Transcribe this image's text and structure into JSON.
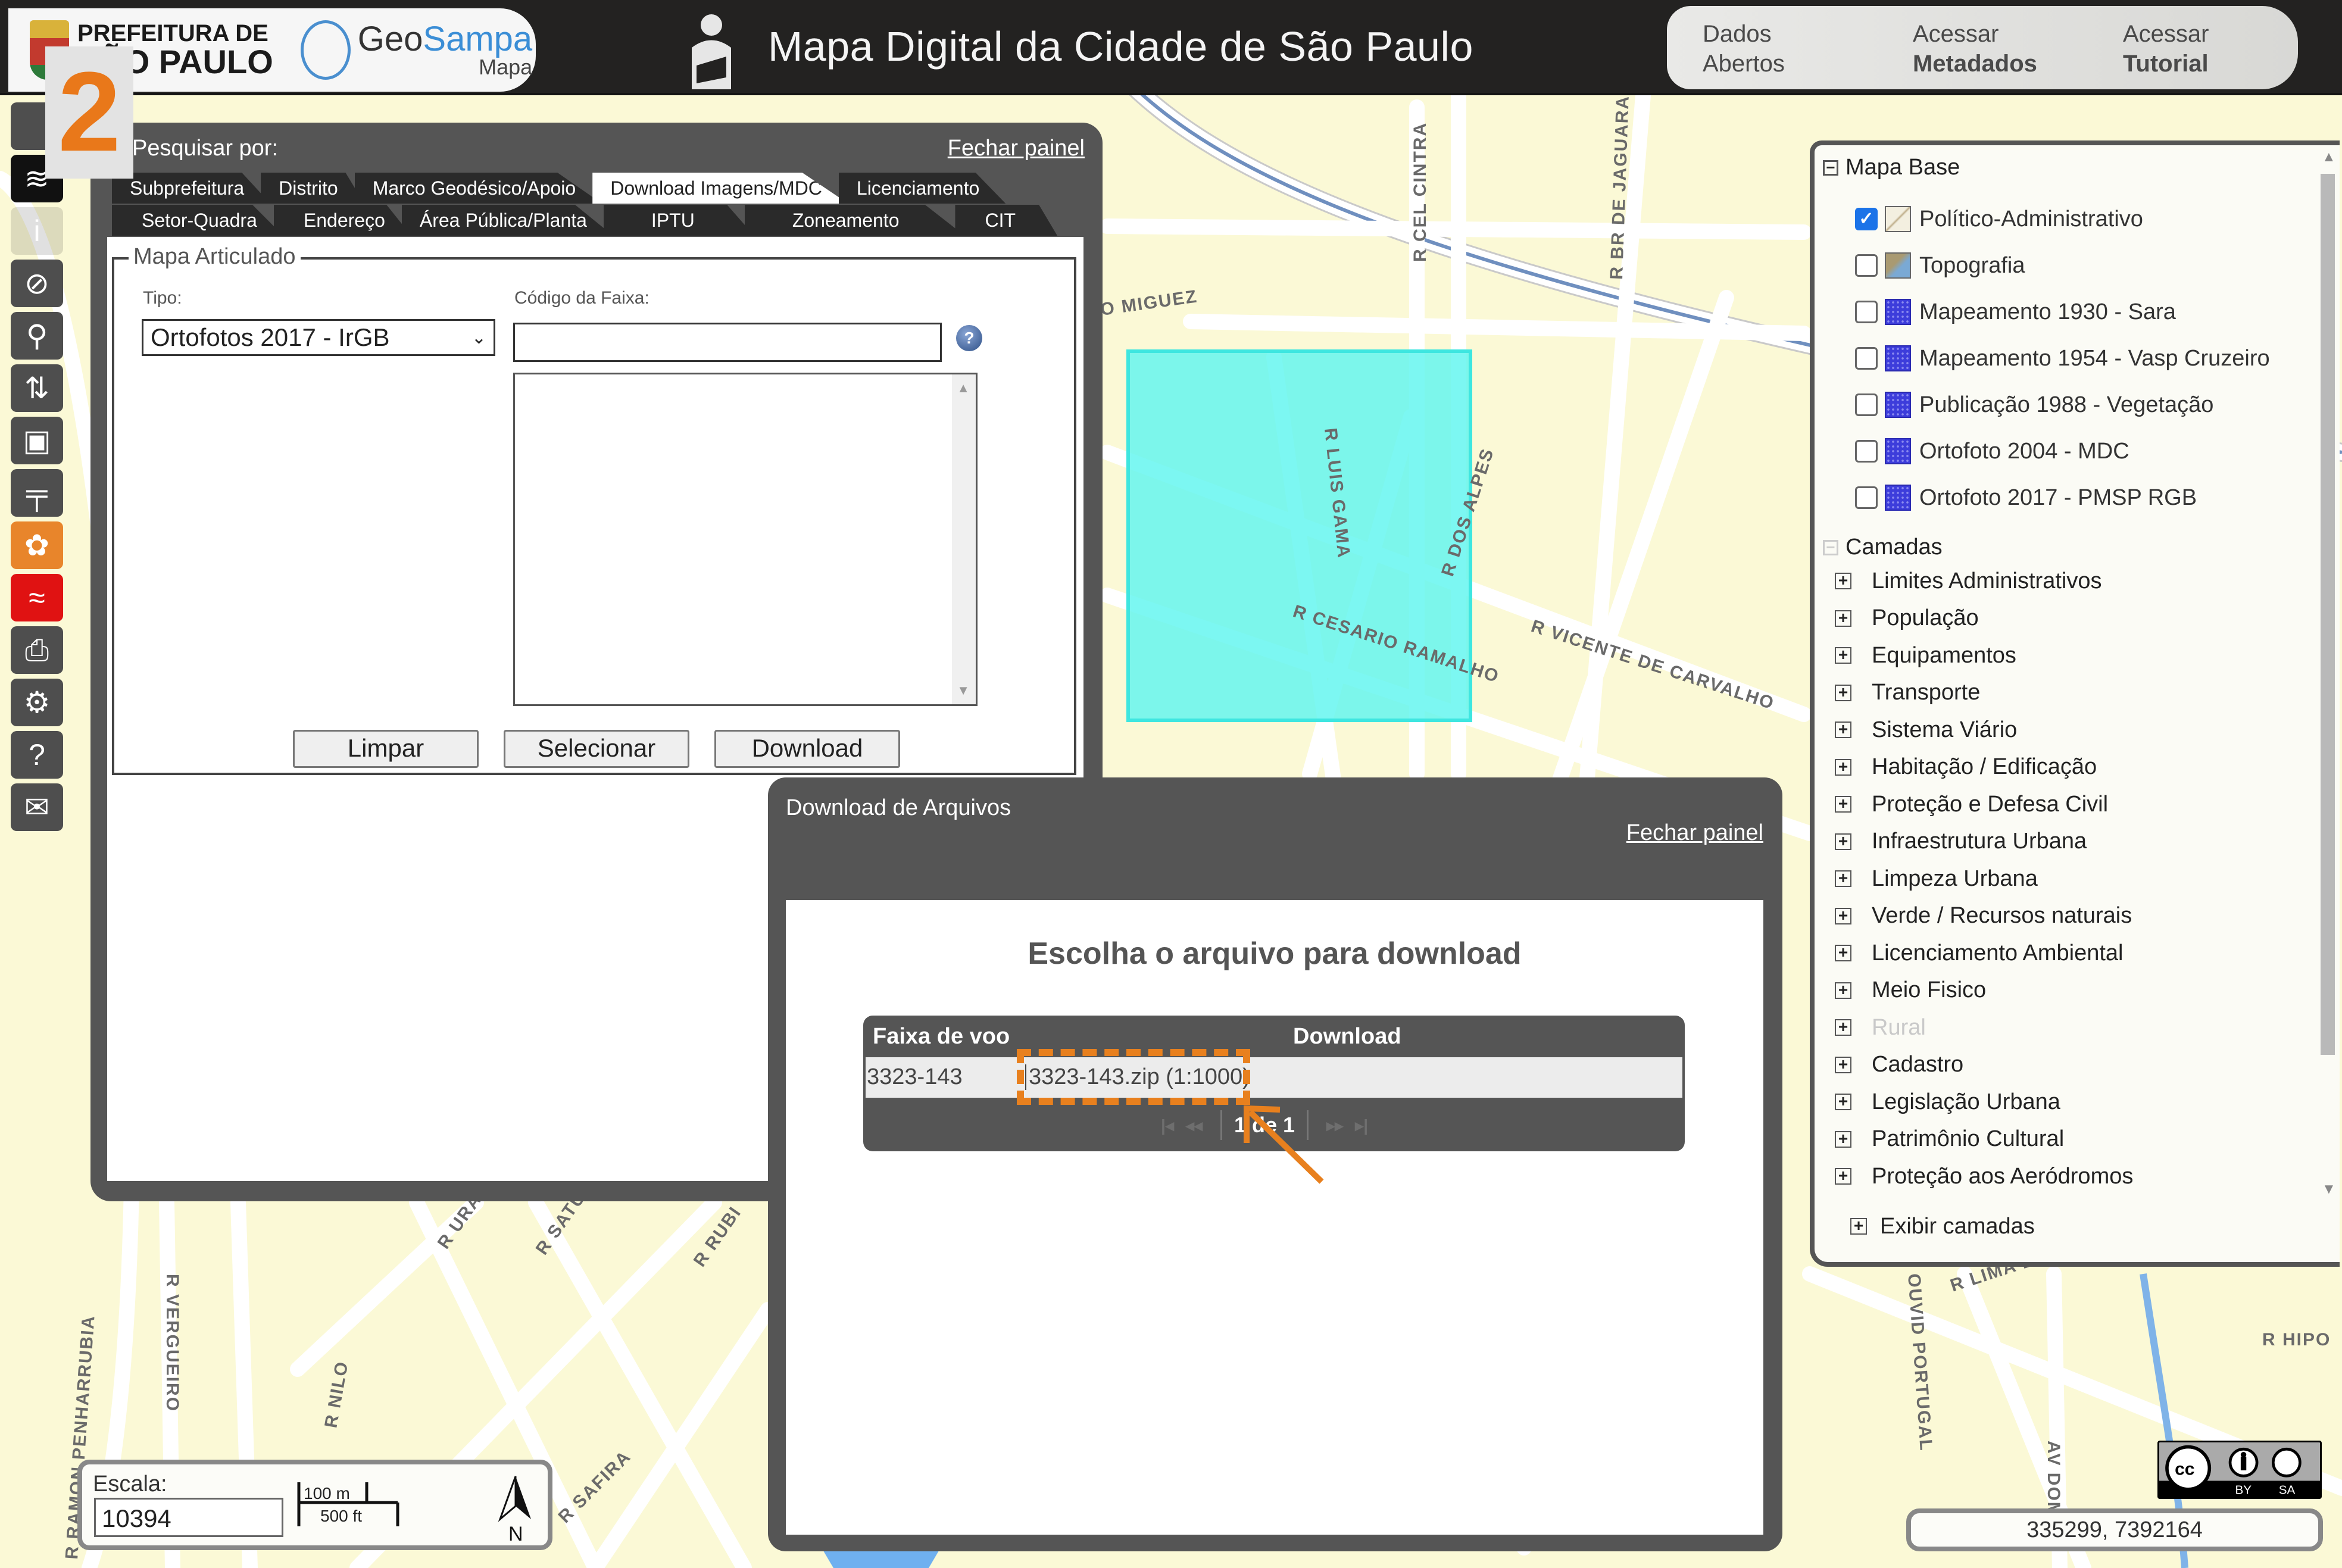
{
  "header": {
    "prefeitura_line1": "PREFEITURA DE",
    "prefeitura_line2": "SÃO PAULO",
    "geo_brand_a": "Geo",
    "geo_brand_b": "Sampa",
    "geo_sub": "Mapa",
    "title": "Mapa Digital da Cidade de São Paulo",
    "links": [
      {
        "line1": "Dados",
        "line2": "Abertos"
      },
      {
        "line1": "Acessar",
        "line2": "Metadados"
      },
      {
        "line1": "Acessar",
        "line2": "Tutorial"
      }
    ]
  },
  "step_badge": "2",
  "toolbar": {
    "items": [
      {
        "icon": "blank-tool-icon",
        "glyph": ""
      },
      {
        "icon": "layers-icon",
        "glyph": "≋"
      },
      {
        "icon": "street-view-icon",
        "glyph": "i"
      },
      {
        "icon": "measure-disabled-icon",
        "glyph": "⊘"
      },
      {
        "icon": "search-icon",
        "glyph": "⚲"
      },
      {
        "icon": "route-icon",
        "glyph": "⇅"
      },
      {
        "icon": "save-icon",
        "glyph": "▣"
      },
      {
        "icon": "ruler-icon",
        "glyph": "╤"
      },
      {
        "icon": "palette-icon",
        "glyph": "✿"
      },
      {
        "icon": "flood-icon",
        "glyph": "≈"
      },
      {
        "icon": "print-icon",
        "glyph": "⎙"
      },
      {
        "icon": "settings-icon",
        "glyph": "⚙"
      },
      {
        "icon": "help-icon",
        "glyph": "?"
      },
      {
        "icon": "mail-icon",
        "glyph": "✉"
      }
    ]
  },
  "search_panel": {
    "title": "Pesquisar por:",
    "close": "Fechar painel",
    "tabs_row1": [
      "Subprefeitura",
      "Distrito",
      "Marco Geodésico/Apoio",
      "Download Imagens/MDC",
      "Licenciamento"
    ],
    "tabs_row2": [
      "Setor-Quadra",
      "Endereço",
      "Área Pública/Planta",
      "IPTU",
      "Zoneamento",
      "CIT"
    ],
    "active_tab": "Download Imagens/MDC",
    "fieldset_legend": "Mapa Articulado",
    "tipo_label": "Tipo:",
    "tipo_value": "Ortofotos 2017 - IrGB",
    "codigo_label": "Código da Faixa:",
    "codigo_value": "",
    "help_glyph": "?",
    "buttons": {
      "clear": "Limpar",
      "select": "Selecionar",
      "download": "Download"
    }
  },
  "layer_panel": {
    "base_title": "Mapa Base",
    "base_items": [
      {
        "label": "Político-Administrativo",
        "checked": true,
        "thumb": "pol"
      },
      {
        "label": "Topografia",
        "checked": false,
        "thumb": "topo"
      },
      {
        "label": "Mapeamento 1930 - Sara",
        "checked": false,
        "thumb": "img"
      },
      {
        "label": "Mapeamento 1954 - Vasp Cruzeiro",
        "checked": false,
        "thumb": "img"
      },
      {
        "label": "Publicação 1988 - Vegetação",
        "checked": false,
        "thumb": "img"
      },
      {
        "label": "Ortofoto 2004 - MDC",
        "checked": false,
        "thumb": "img"
      },
      {
        "label": "Ortofoto 2017 - PMSP RGB",
        "checked": false,
        "thumb": "img"
      }
    ],
    "camadas_title": "Camadas",
    "camadas": [
      {
        "label": "Limites Administrativos",
        "enabled": true
      },
      {
        "label": "População",
        "enabled": true
      },
      {
        "label": "Equipamentos",
        "enabled": true
      },
      {
        "label": "Transporte",
        "enabled": true
      },
      {
        "label": "Sistema Viário",
        "enabled": true
      },
      {
        "label": "Habitação / Edificação",
        "enabled": true
      },
      {
        "label": "Proteção e Defesa Civil",
        "enabled": true
      },
      {
        "label": "Infraestrutura Urbana",
        "enabled": true
      },
      {
        "label": "Limpeza Urbana",
        "enabled": true
      },
      {
        "label": "Verde / Recursos naturais",
        "enabled": true
      },
      {
        "label": "Licenciamento Ambiental",
        "enabled": true
      },
      {
        "label": "Meio Fisico",
        "enabled": true
      },
      {
        "label": "Rural",
        "enabled": false
      },
      {
        "label": "Cadastro",
        "enabled": true
      },
      {
        "label": "Legislação Urbana",
        "enabled": true
      },
      {
        "label": "Patrimônio Cultural",
        "enabled": true
      },
      {
        "label": "Proteção aos Aeródromos",
        "enabled": true
      }
    ],
    "show_layers": "Exibir camadas"
  },
  "download_panel": {
    "title": "Download de Arquivos",
    "close": "Fechar painel",
    "heading": "Escolha o arquivo para download",
    "columns": [
      "Faixa de voo",
      "Download"
    ],
    "rows": [
      {
        "faixa": "3323-143",
        "file": "3323-143.zip (1:1000)"
      }
    ],
    "pager": {
      "first": "|◂",
      "prev": "◂◂",
      "text": "1 de 1",
      "next": "▸▸",
      "last": "▸|"
    },
    "highlight_color": "#e8801e"
  },
  "map": {
    "street_labels": [
      "R CEL CINTRA",
      "R BR DE JAGUARA",
      "O MIGUEZ",
      "R LUIS GAMA",
      "R DOS ALPES",
      "R CESARIO RAMALHO",
      "R VICENTE DE CARVALHO",
      "R VERGUEIRO",
      "R NILO",
      "R URA",
      "R SATU",
      "R RUBI",
      "R LIMA BARRETO",
      "R HIPO",
      "AV DOM",
      "OUVID PORTUGAL",
      "R SAFIRA",
      "R RAMON PENHARRUBIA"
    ],
    "selection_color": "#5ff5ef"
  },
  "scale": {
    "label": "Escala:",
    "value": "10394",
    "bar_top": "100 m",
    "bar_bottom": "500 ft",
    "north": "N"
  },
  "license": {
    "by": "BY",
    "sa": "SA",
    "cc": "cc"
  },
  "coordinates": "335299, 7392164"
}
